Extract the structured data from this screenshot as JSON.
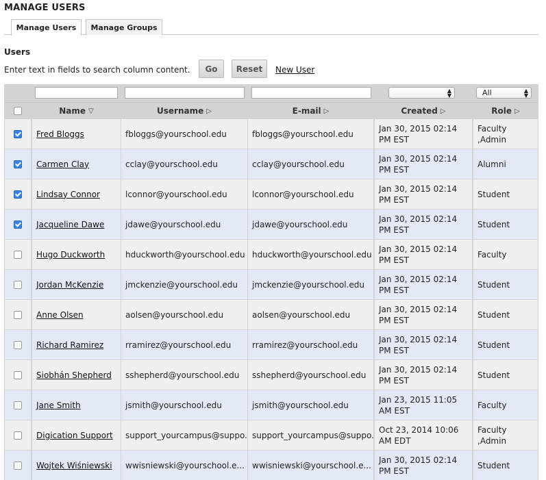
{
  "page_title": "MANAGE USERS",
  "tabs": [
    {
      "label": "Manage Users",
      "active": true
    },
    {
      "label": "Manage Groups",
      "active": false
    }
  ],
  "section_title": "Users",
  "search_hint": "Enter text in fields to search column content.",
  "buttons": {
    "go": "Go",
    "reset": "Reset",
    "new_user": "New User"
  },
  "filters": {
    "created_select": "",
    "role_select": "All"
  },
  "columns": [
    {
      "label": "Name",
      "sort": "desc"
    },
    {
      "label": "Username",
      "sort": "none"
    },
    {
      "label": "E-mail",
      "sort": "none"
    },
    {
      "label": "Created",
      "sort": "none"
    },
    {
      "label": "Role",
      "sort": "none"
    }
  ],
  "sort_icons": {
    "desc": "▽",
    "none": "▷"
  },
  "users": [
    {
      "checked": true,
      "name": "Fred Bloggs",
      "username": "fbloggs@yourschool.edu",
      "email": "fbloggs@yourschool.edu",
      "created": "Jan 30, 2015 02:14 PM EST",
      "role": "Faculty ,Admin"
    },
    {
      "checked": true,
      "name": "Carmen Clay",
      "username": "cclay@yourschool.edu",
      "email": "cclay@yourschool.edu",
      "created": "Jan 30, 2015 02:14 PM EST",
      "role": "Alumni"
    },
    {
      "checked": true,
      "name": "Lindsay Connor",
      "username": "lconnor@yourschool.edu",
      "email": "lconnor@yourschool.edu",
      "created": "Jan 30, 2015 02:14 PM EST",
      "role": "Student"
    },
    {
      "checked": true,
      "name": "Jacqueline Dawe",
      "username": "jdawe@yourschool.edu",
      "email": "jdawe@yourschool.edu",
      "created": "Jan 30, 2015 02:14 PM EST",
      "role": "Student"
    },
    {
      "checked": false,
      "name": "Hugo Duckworth",
      "username": "hduckworth@yourschool.edu",
      "email": "hduckworth@yourschool.edu",
      "created": "Jan 30, 2015 02:14 PM EST",
      "role": "Faculty"
    },
    {
      "checked": false,
      "name": "Jordan McKenzie",
      "username": "jmckenzie@yourschool.edu",
      "email": "jmckenzie@yourschool.edu",
      "created": "Jan 30, 2015 02:14 PM EST",
      "role": "Student"
    },
    {
      "checked": false,
      "name": "Anne Olsen",
      "username": "aolsen@yourschool.edu",
      "email": "aolsen@yourschool.edu",
      "created": "Jan 30, 2015 02:14 PM EST",
      "role": "Student"
    },
    {
      "checked": false,
      "name": "Richard Ramirez",
      "username": "rramirez@yourschool.edu",
      "email": "rramirez@yourschool.edu",
      "created": "Jan 30, 2015 02:14 PM EST",
      "role": "Student"
    },
    {
      "checked": false,
      "name": "Siobhán Shepherd",
      "username": "sshepherd@yourschool.edu",
      "email": "sshepherd@yourschool.edu",
      "created": "Jan 30, 2015 02:14 PM EST",
      "role": "Student"
    },
    {
      "checked": false,
      "name": "Jane Smith",
      "username": "jsmith@yourschool.edu",
      "email": "jsmith@yourschool.edu",
      "created": "Jan 23, 2015 11:05 AM EST",
      "role": "Faculty"
    },
    {
      "checked": false,
      "name": "Digication Support",
      "username": "support_yourcampus@suppo...",
      "email": "support_yourcampus@suppo...",
      "created": "Oct 23, 2014 10:06 AM EDT",
      "role": "Faculty ,Admin"
    },
    {
      "checked": false,
      "name": "Wojtek Wiśniewski",
      "username": "wwisniewski@yourschool.e...",
      "email": "wwisniewski@yourschool.e...",
      "created": "Jan 30, 2015 02:14 PM EST",
      "role": "Student"
    }
  ]
}
